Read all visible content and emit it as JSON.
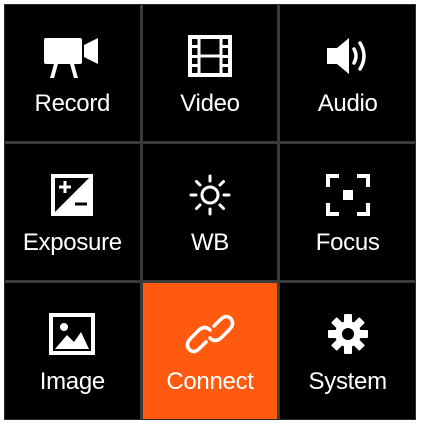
{
  "menu": {
    "active_color": "#ff5a10",
    "items": [
      {
        "label": "Record",
        "icon": "video-camera-icon"
      },
      {
        "label": "Video",
        "icon": "film-strip-icon"
      },
      {
        "label": "Audio",
        "icon": "speaker-icon"
      },
      {
        "label": "Exposure",
        "icon": "exposure-icon"
      },
      {
        "label": "WB",
        "icon": "sun-icon"
      },
      {
        "label": "Focus",
        "icon": "focus-frame-icon"
      },
      {
        "label": "Image",
        "icon": "picture-icon"
      },
      {
        "label": "Connect",
        "icon": "link-icon",
        "selected": true
      },
      {
        "label": "System",
        "icon": "gear-icon"
      }
    ]
  }
}
